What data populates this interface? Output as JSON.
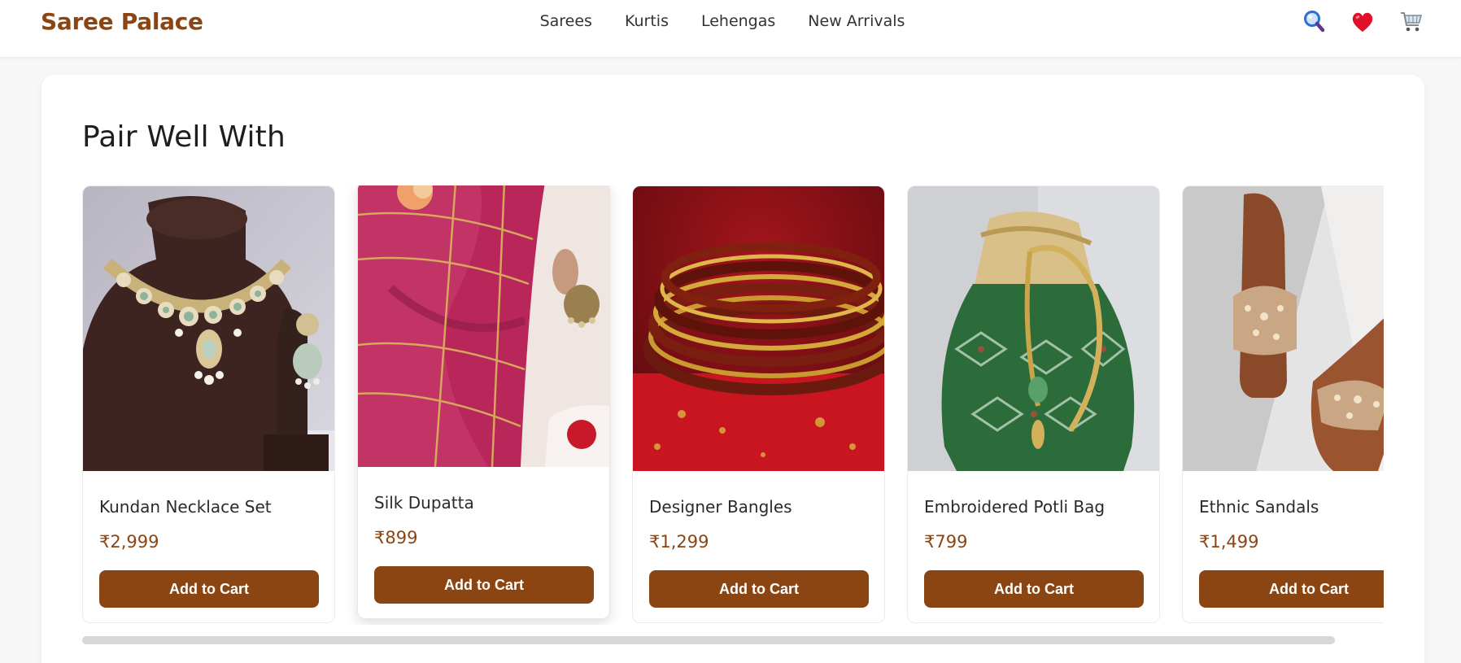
{
  "header": {
    "logo": "Saree Palace",
    "nav": [
      "Sarees",
      "Kurtis",
      "Lehengas",
      "New Arrivals"
    ],
    "icons": [
      "search-icon",
      "heart-icon",
      "cart-icon"
    ]
  },
  "section": {
    "title": "Pair Well With"
  },
  "products": [
    {
      "name": "Kundan Necklace Set",
      "price": "₹2,999",
      "button": "Add to Cart",
      "image": "necklace-image"
    },
    {
      "name": "Silk Dupatta",
      "price": "₹899",
      "button": "Add to Cart",
      "image": "dupatta-image"
    },
    {
      "name": "Designer Bangles",
      "price": "₹1,299",
      "button": "Add to Cart",
      "image": "bangles-image"
    },
    {
      "name": "Embroidered Potli Bag",
      "price": "₹799",
      "button": "Add to Cart",
      "image": "potli-bag-image"
    },
    {
      "name": "Ethnic Sandals",
      "price": "₹1,499",
      "button": "Add to Cart",
      "image": "sandals-image"
    }
  ],
  "colors": {
    "brand": "#8b4513",
    "heart": "#e0102a",
    "search": "#2a6fd6"
  }
}
